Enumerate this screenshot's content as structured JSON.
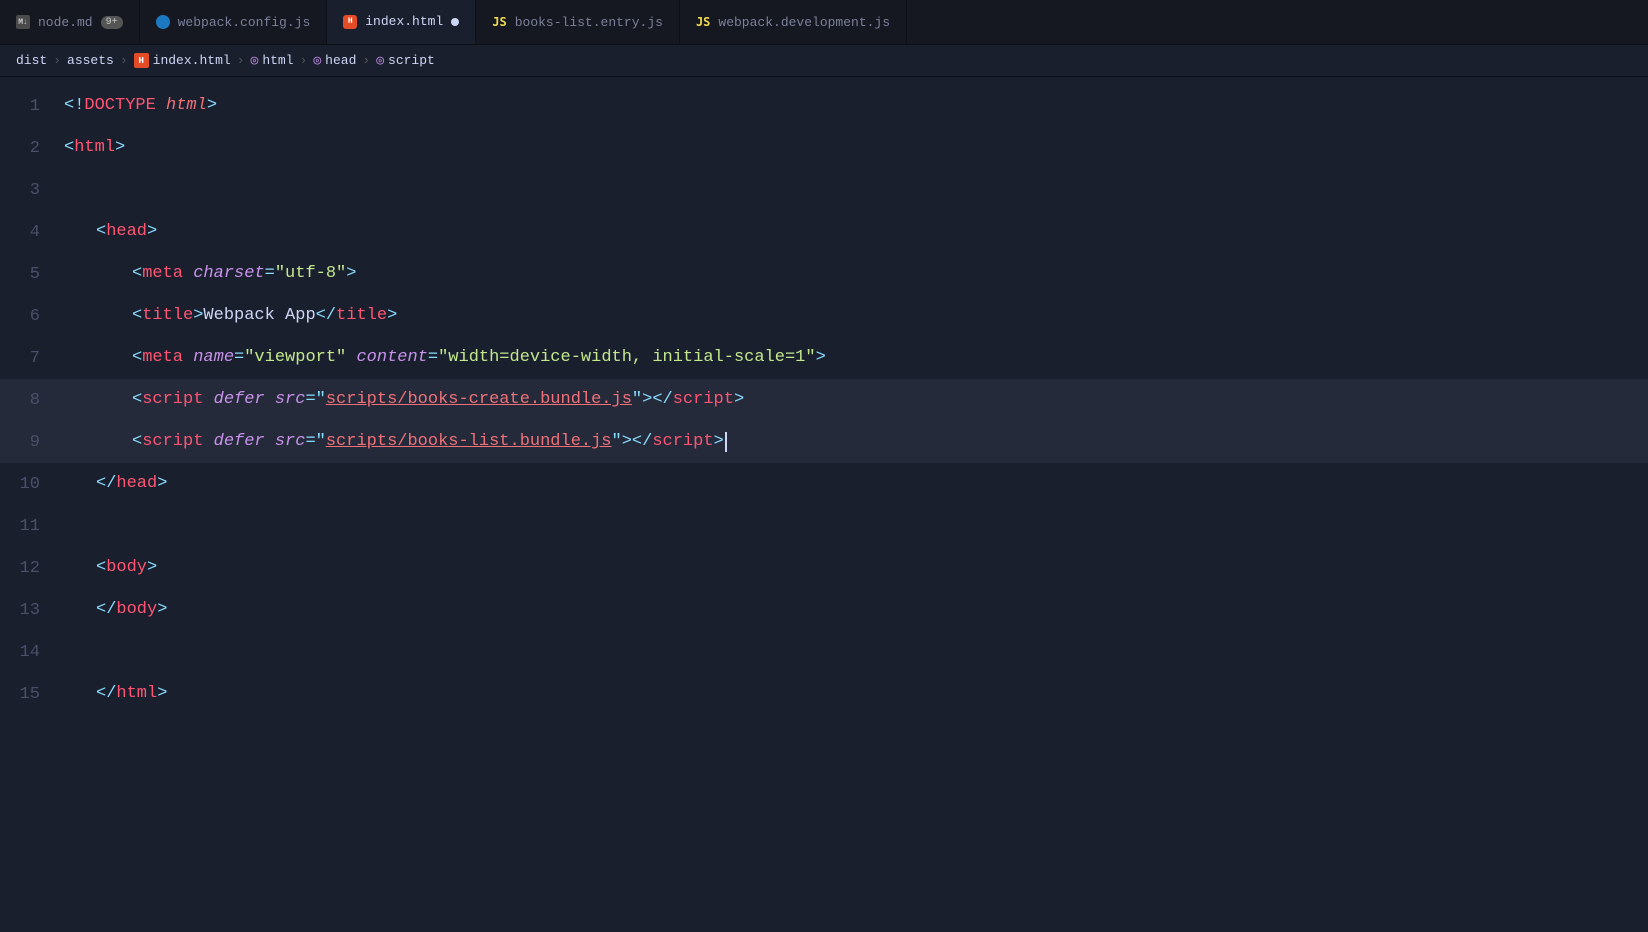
{
  "tabs": [
    {
      "id": "node-md",
      "label": "node.md",
      "type": "md",
      "badge": "9+",
      "active": false
    },
    {
      "id": "webpack-config",
      "label": "webpack.config.js",
      "type": "webpack",
      "active": false
    },
    {
      "id": "index-html",
      "label": "index.html",
      "type": "html",
      "modified": true,
      "active": true
    },
    {
      "id": "books-list-entry",
      "label": "books-list.entry.js",
      "type": "js",
      "active": false
    },
    {
      "id": "webpack-development",
      "label": "webpack.development.js",
      "type": "js",
      "active": false
    }
  ],
  "breadcrumb": {
    "items": [
      "dist",
      "assets",
      "index.html",
      "html",
      "head",
      "script"
    ]
  },
  "lines": [
    {
      "number": 1,
      "content": "doctype"
    },
    {
      "number": 2,
      "content": "html-open"
    },
    {
      "number": 3,
      "content": "empty"
    },
    {
      "number": 4,
      "content": "head-open"
    },
    {
      "number": 5,
      "content": "meta-charset"
    },
    {
      "number": 6,
      "content": "title"
    },
    {
      "number": 7,
      "content": "meta-viewport"
    },
    {
      "number": 8,
      "content": "script-create",
      "highlighted": true
    },
    {
      "number": 9,
      "content": "script-list",
      "highlighted": true,
      "cursor": true
    },
    {
      "number": 10,
      "content": "head-close"
    },
    {
      "number": 11,
      "content": "empty"
    },
    {
      "number": 12,
      "content": "body-open"
    },
    {
      "number": 13,
      "content": "body-close"
    },
    {
      "number": 14,
      "content": "empty"
    },
    {
      "number": 15,
      "content": "html-close"
    }
  ]
}
